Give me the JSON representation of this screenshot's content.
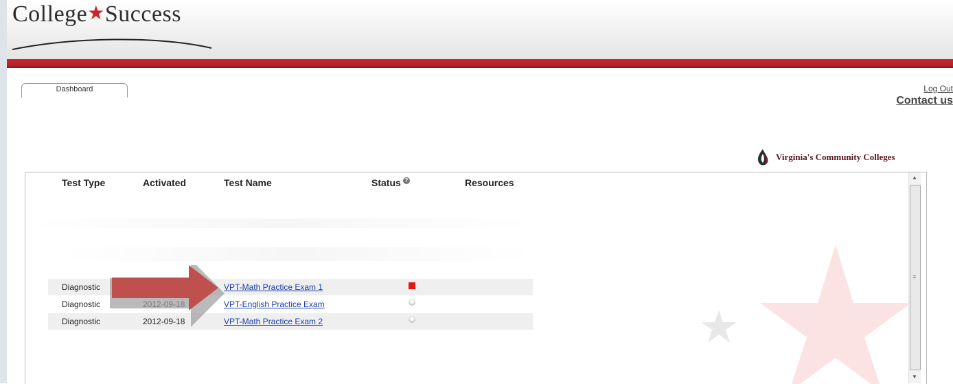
{
  "brand": {
    "logo_left": "College",
    "logo_star": "★",
    "logo_right": "Success",
    "accent": "#c8282e"
  },
  "nav": {
    "tab_dashboard": "Dashboard",
    "logout": "Log Out",
    "contact": "Contact us"
  },
  "partner": {
    "name": "Virginia's Community Colleges"
  },
  "table": {
    "headers": [
      "Test Type",
      "Activated",
      "Test Name",
      "Status",
      "Resources"
    ],
    "rows": [
      {
        "type": "Diagnostic",
        "activated": "",
        "name": "VPT-Math Practice Exam 1",
        "status": "red"
      },
      {
        "type": "Diagnostic",
        "activated": "2012-09-18",
        "name": "VPT-English Practice Exam",
        "status": "grey"
      },
      {
        "type": "Diagnostic",
        "activated": "2012-09-18",
        "name": "VPT-Math Practice Exam 2",
        "status": "grey"
      }
    ]
  },
  "icons": {
    "status_help": "help-icon",
    "arrow": "arrow-overlay-icon"
  }
}
